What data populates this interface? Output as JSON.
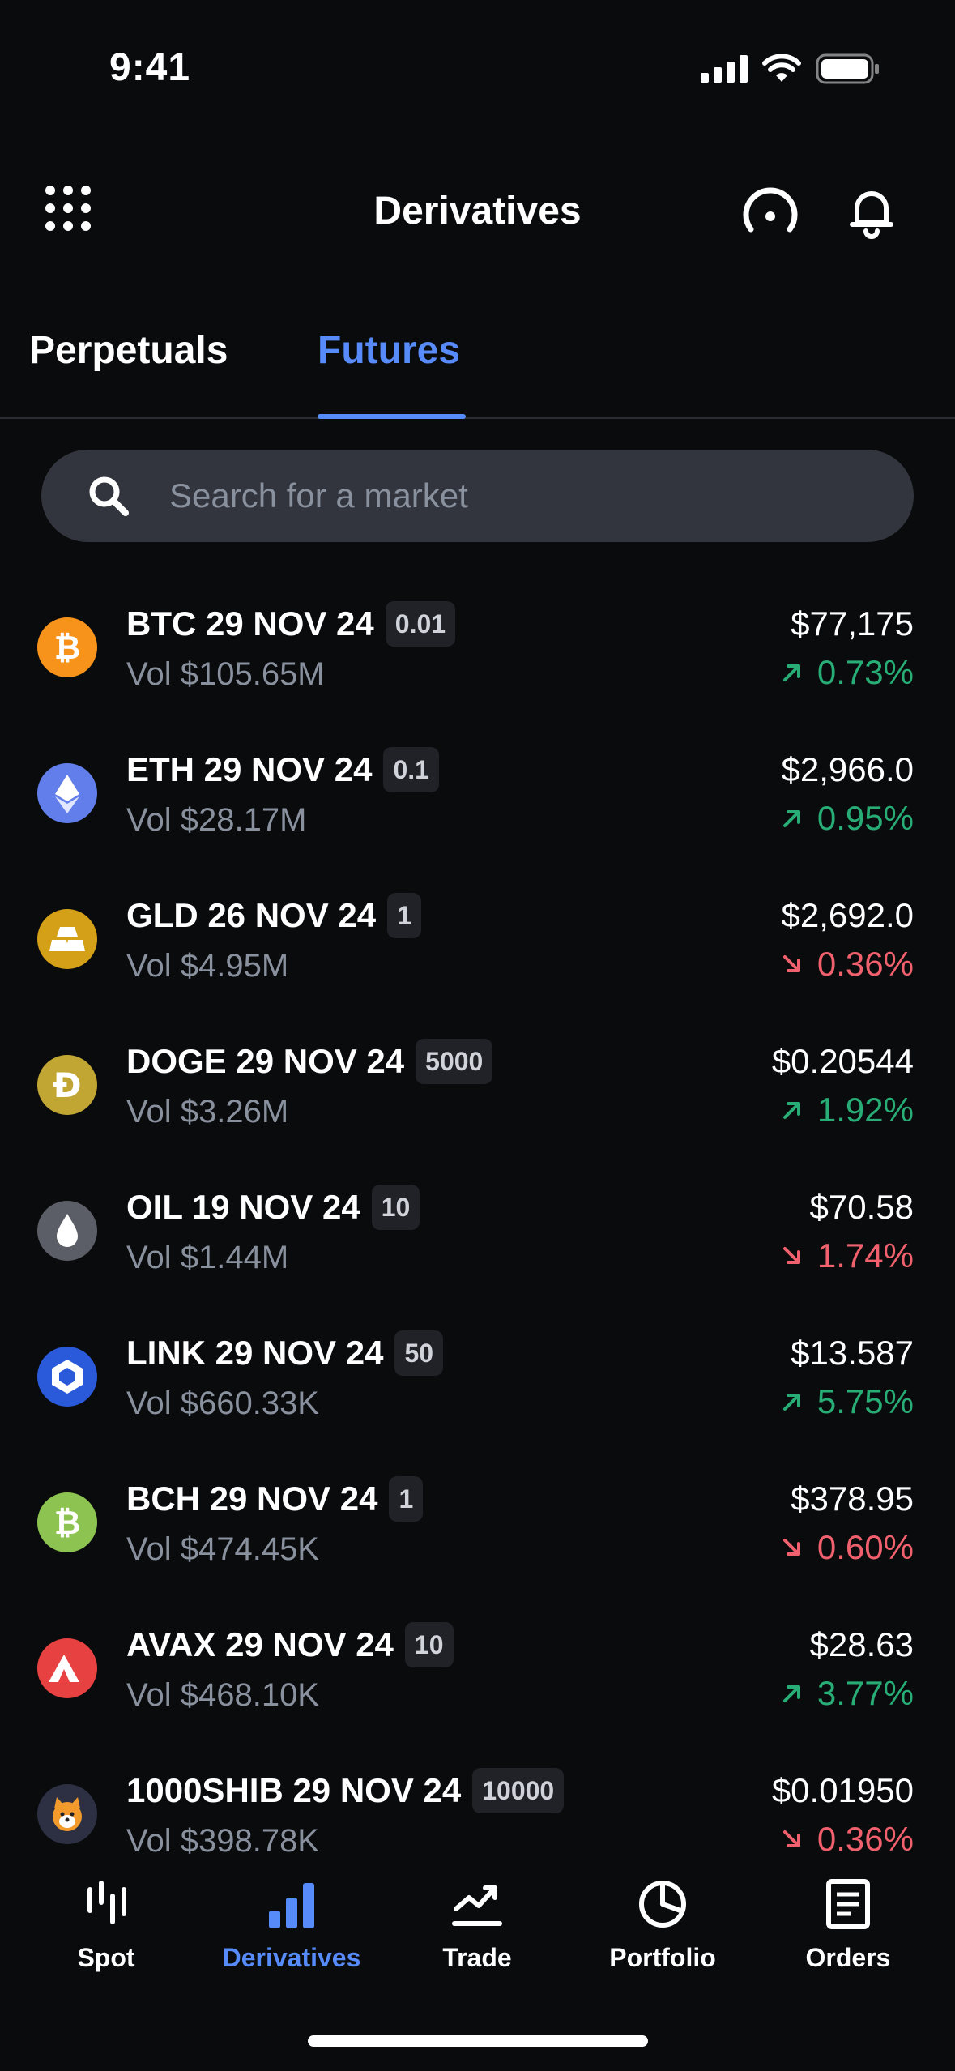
{
  "status": {
    "time": "9:41"
  },
  "header": {
    "title": "Derivatives"
  },
  "tabs": [
    {
      "label": "Perpetuals"
    },
    {
      "label": "Futures"
    }
  ],
  "search": {
    "placeholder": "Search for a market"
  },
  "markets": [
    {
      "name": "BTC 29 NOV 24",
      "badge": "0.01",
      "vol": "Vol $105.65M",
      "price": "$77,175",
      "change": "0.73%",
      "direction": "up",
      "icon": "bitcoin-icon",
      "color": "#f7931a"
    },
    {
      "name": "ETH 29 NOV 24",
      "badge": "0.1",
      "vol": "Vol $28.17M",
      "price": "$2,966.0",
      "change": "0.95%",
      "direction": "up",
      "icon": "ethereum-icon",
      "color": "#627eea"
    },
    {
      "name": "GLD 26 NOV 24",
      "badge": "1",
      "vol": "Vol $4.95M",
      "price": "$2,692.0",
      "change": "0.36%",
      "direction": "down",
      "icon": "gold-bar-icon",
      "color": "#d4a017"
    },
    {
      "name": "DOGE 29 NOV 24",
      "badge": "5000",
      "vol": "Vol $3.26M",
      "price": "$0.20544",
      "change": "1.92%",
      "direction": "up",
      "icon": "dogecoin-icon",
      "color": "#c2a633"
    },
    {
      "name": "OIL 19 NOV 24",
      "badge": "10",
      "vol": "Vol $1.44M",
      "price": "$70.58",
      "change": "1.74%",
      "direction": "down",
      "icon": "oil-drop-icon",
      "color": "#5b5e66"
    },
    {
      "name": "LINK 29 NOV 24",
      "badge": "50",
      "vol": "Vol $660.33K",
      "price": "$13.587",
      "change": "5.75%",
      "direction": "up",
      "icon": "chainlink-icon",
      "color": "#2a5ada"
    },
    {
      "name": "BCH 29 NOV 24",
      "badge": "1",
      "vol": "Vol $474.45K",
      "price": "$378.95",
      "change": "0.60%",
      "direction": "down",
      "icon": "bitcoin-cash-icon",
      "color": "#8dc351"
    },
    {
      "name": "AVAX 29 NOV 24",
      "badge": "10",
      "vol": "Vol $468.10K",
      "price": "$28.63",
      "change": "3.77%",
      "direction": "up",
      "icon": "avalanche-icon",
      "color": "#e84142"
    },
    {
      "name": "1000SHIB 29 NOV 24",
      "badge": "10000",
      "vol": "Vol $398.78K",
      "price": "$0.01950",
      "change": "0.36%",
      "direction": "down",
      "icon": "shiba-icon",
      "color": "#2d3042"
    }
  ],
  "nav": [
    {
      "label": "Spot",
      "icon": "spot-icon"
    },
    {
      "label": "Derivatives",
      "icon": "bar-chart-icon"
    },
    {
      "label": "Trade",
      "icon": "trend-icon"
    },
    {
      "label": "Portfolio",
      "icon": "pie-chart-icon"
    },
    {
      "label": "Orders",
      "icon": "document-icon"
    }
  ],
  "colors": {
    "accent": "#578bfa",
    "up": "#27ad75",
    "down": "#f0616d",
    "background": "#0a0b0d"
  }
}
